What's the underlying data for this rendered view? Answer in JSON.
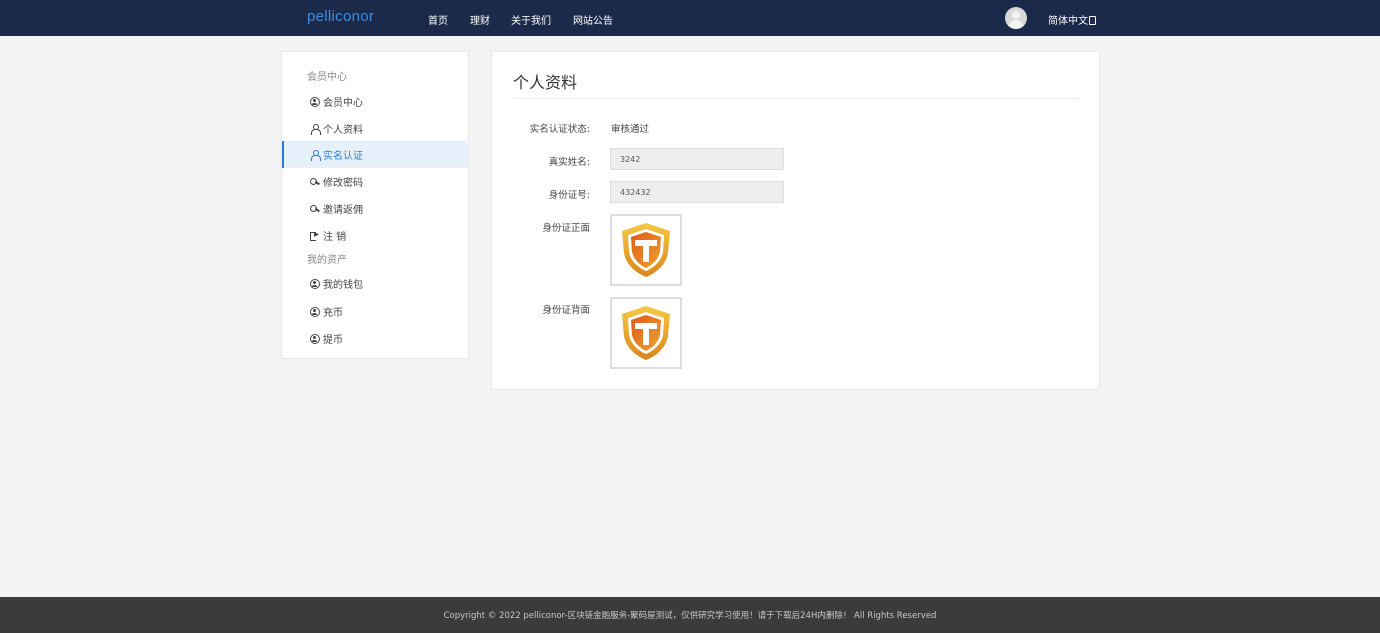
{
  "header": {
    "brand": "pelliconor",
    "nav": [
      "首页",
      "理财",
      "关于我们",
      "网站公告"
    ],
    "language": "简体中文",
    "avatar_icon": "user-avatar-icon",
    "colors": {
      "bar": "#1b2a4a",
      "brand": "#3a8ee6"
    }
  },
  "sidebar": {
    "group1": "会员中心",
    "items1": [
      {
        "label": "会员中心",
        "icon": "user-circle-icon"
      },
      {
        "label": "个人资料",
        "icon": "user-icon"
      },
      {
        "label": "实名认证",
        "icon": "user-icon",
        "active": true
      },
      {
        "label": "修改密码",
        "icon": "key-icon"
      },
      {
        "label": "邀请返佣",
        "icon": "key-icon"
      },
      {
        "label": "注 销",
        "icon": "logout-icon"
      }
    ],
    "group2": "我的资产",
    "items2": [
      {
        "label": "我的钱包",
        "icon": "user-circle-icon"
      },
      {
        "label": "充币",
        "icon": "user-circle-icon"
      },
      {
        "label": "提币",
        "icon": "user-circle-icon"
      }
    ],
    "active_color": "#2b7fd9"
  },
  "main": {
    "title": "个人资料",
    "status_label": "实名认证状态:",
    "status_value": "审核通过",
    "name_label": "真实姓名:",
    "name_value": "3242",
    "id_label": "身份证号:",
    "id_value": "432432",
    "front_label": "身份证正面",
    "back_label": "身份证背面",
    "id_image_icon": "shield-logo-icon"
  },
  "footer": {
    "text": "Copyright © 2022 pelliconor-区块链金融服务-聚码屋测试，仅供研究学习使用！请于下载后24H内删除！ All Rights Reserved"
  }
}
